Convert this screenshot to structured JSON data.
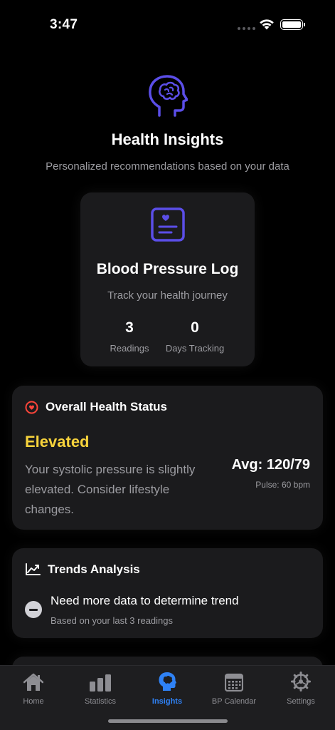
{
  "status_bar": {
    "time": "3:47"
  },
  "header": {
    "title": "Health Insights",
    "subtitle": "Personalized recommendations based on your data"
  },
  "log_card": {
    "title": "Blood Pressure Log",
    "subtitle": "Track your health journey",
    "stats": [
      {
        "value": "3",
        "label": "Readings"
      },
      {
        "value": "0",
        "label": "Days Tracking"
      }
    ]
  },
  "health_status": {
    "title": "Overall Health Status",
    "level": "Elevated",
    "description": "Your systolic pressure is slightly elevated. Consider lifestyle changes.",
    "average": "Avg: 120/79",
    "pulse": "Pulse: 60 bpm"
  },
  "trends": {
    "title": "Trends Analysis",
    "message": "Need more data to determine trend",
    "detail": "Based on your last 3 readings"
  },
  "tabs": [
    {
      "label": "Home",
      "icon": "house-icon"
    },
    {
      "label": "Statistics",
      "icon": "bar-chart-icon"
    },
    {
      "label": "Insights",
      "icon": "brain-head-icon"
    },
    {
      "label": "BP Calendar",
      "icon": "calendar-icon"
    },
    {
      "label": "Settings",
      "icon": "gear-icon"
    }
  ],
  "colors": {
    "accent_purple": "#5b4ee8",
    "elevated_yellow": "#f7d33c",
    "active_tab_blue": "#2f82f5",
    "heart_red": "#ff453a"
  }
}
